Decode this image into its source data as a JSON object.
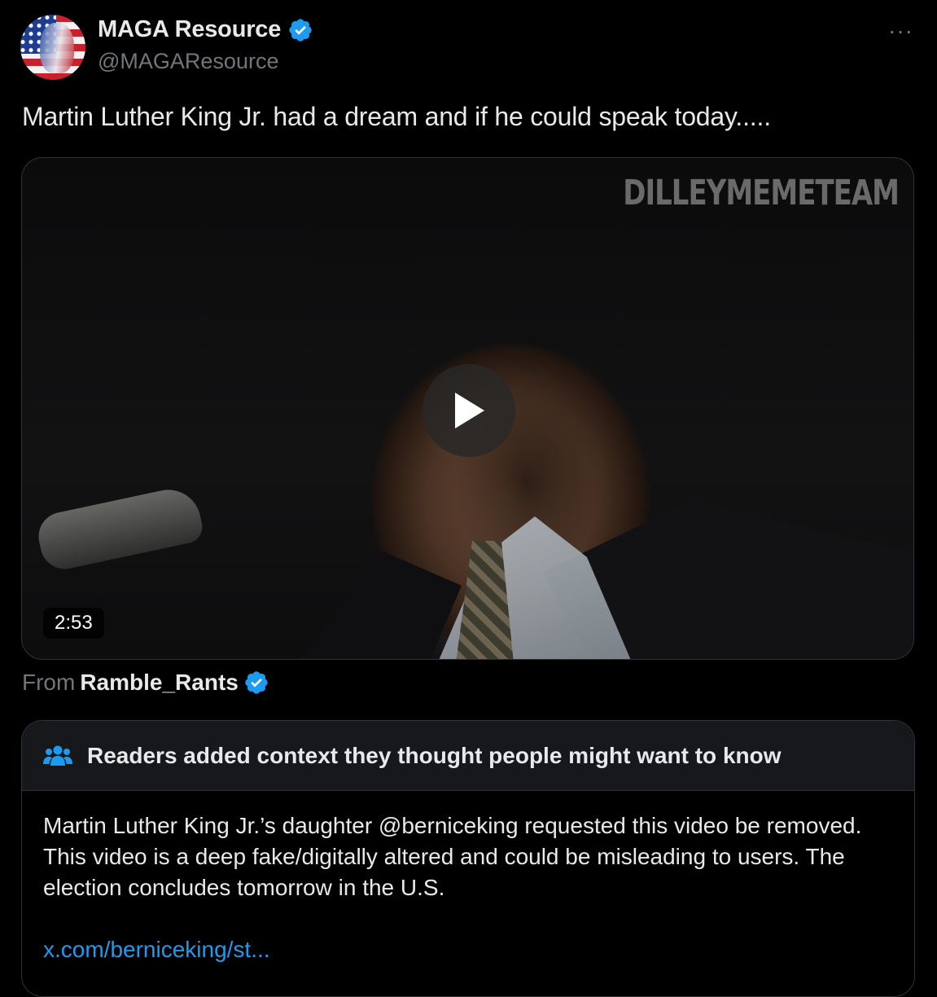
{
  "author": {
    "display_name": "MAGA Resource",
    "handle": "@MAGAResource"
  },
  "tweet": {
    "text": "Martin Luther King Jr. had a dream and if he could speak today.....",
    "more_icon": "···"
  },
  "video": {
    "watermark": "DILLEYMEMETEAM",
    "duration": "2:53"
  },
  "source": {
    "from_label": "From",
    "name": "Ramble_Rants"
  },
  "community_note": {
    "title": "Readers added context they thought people might want to know",
    "body": "Martin Luther King Jr.’s daughter @berniceking requested this video be removed. This video is a deep fake/digitally altered and could be misleading to users. The election concludes tomorrow in the U.S.",
    "link": "x.com/berniceking/st..."
  },
  "colors": {
    "background": "#000000",
    "primary_text": "#e7e9ea",
    "secondary_text": "#71767b",
    "verified_badge": "#1d9bf0",
    "link": "#1d9bf0",
    "note_header_bg": "#16181c"
  },
  "icons": [
    "verified-badge-icon",
    "more-options-icon",
    "play-icon",
    "people-icon"
  ]
}
